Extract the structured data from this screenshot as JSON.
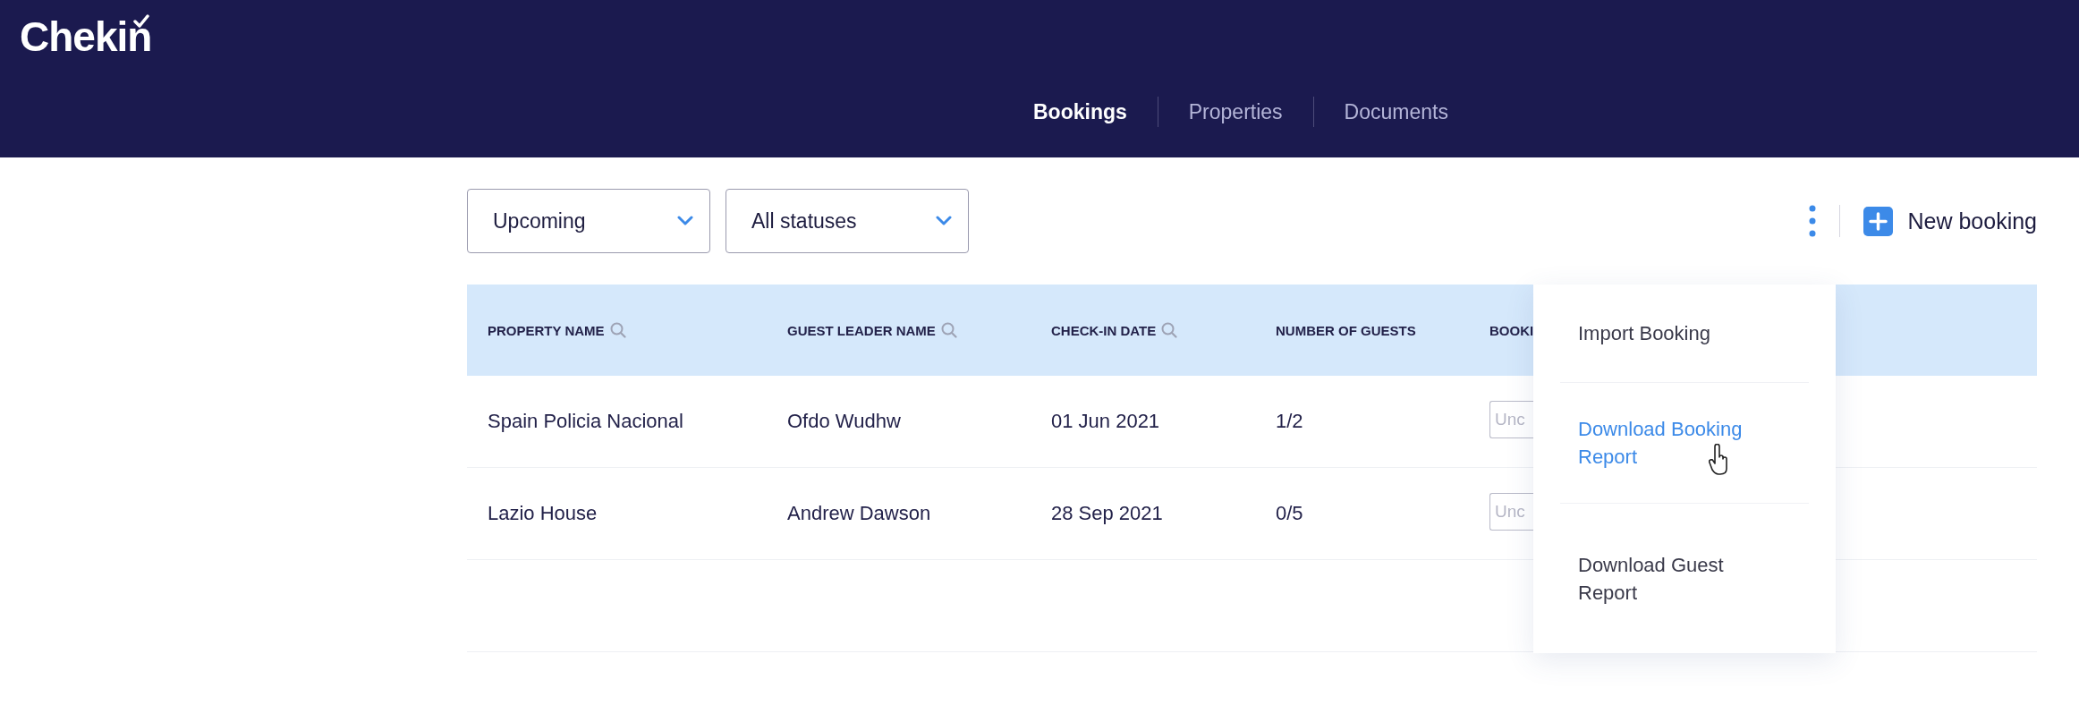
{
  "header": {
    "logo": "Chekin",
    "nav": [
      {
        "label": "Bookings",
        "selected": true
      },
      {
        "label": "Properties",
        "selected": false
      },
      {
        "label": "Documents",
        "selected": false
      }
    ]
  },
  "filters": [
    {
      "value": "Upcoming"
    },
    {
      "value": "All statuses"
    }
  ],
  "actions": {
    "new_booking": "New booking"
  },
  "table": {
    "columns": [
      {
        "label": "PROPERTY NAME",
        "searchable": true
      },
      {
        "label": "GUEST LEADER NAME",
        "searchable": true
      },
      {
        "label": "CHECK-IN DATE",
        "searchable": true
      },
      {
        "label": "NUMBER OF GUESTS",
        "searchable": false
      },
      {
        "label": "BOOKI",
        "searchable": false
      }
    ],
    "rows": [
      {
        "property": "Spain Policia Nacional",
        "guest_leader": "Ofdo Wudhw",
        "check_in": "01 Jun 2021",
        "guests": "1/2",
        "status": "Unc"
      },
      {
        "property": "Lazio House",
        "guest_leader": "Andrew Dawson",
        "check_in": "28 Sep 2021",
        "guests": "0/5",
        "status": "Unc"
      }
    ]
  },
  "menu": {
    "items": [
      {
        "label": "Import Booking",
        "hovered": false
      },
      {
        "label": "Download Booking Report",
        "hovered": true
      },
      {
        "label": "Download Guest Report",
        "hovered": false
      }
    ]
  }
}
